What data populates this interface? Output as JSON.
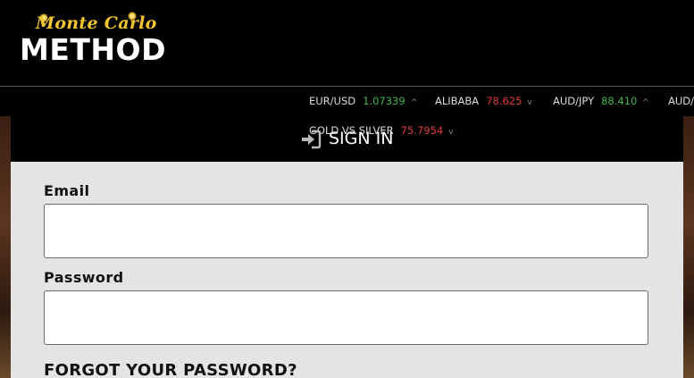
{
  "brand": {
    "script_text": "Monte Carlo",
    "main_text": "METHOD"
  },
  "ticker": [
    {
      "symbol": "EUR/USD",
      "value": "1.07339",
      "trend": "up",
      "arrow": "^"
    },
    {
      "symbol": "ALIBABA",
      "value": "78.625",
      "trend": "down",
      "arrow": "v"
    },
    {
      "symbol": "AUD/JPY",
      "value": "88.410",
      "trend": "up",
      "arrow": "^"
    },
    {
      "symbol": "AUD/",
      "value": "",
      "trend": "",
      "arrow": ""
    },
    {
      "symbol": "GOLD VS SILVER",
      "value": "75.7954",
      "trend": "down",
      "arrow": "v"
    }
  ],
  "signin": {
    "title": "SIGN IN",
    "email_label": "Email",
    "email_value": "",
    "password_label": "Password",
    "password_value": "",
    "forgot_label": "FORGOT YOUR PASSWORD?"
  },
  "colors": {
    "up": "#3cb54a",
    "down": "#e03a3a",
    "logo_gold": "#f2c530",
    "card_bg": "#e4e4e4"
  }
}
